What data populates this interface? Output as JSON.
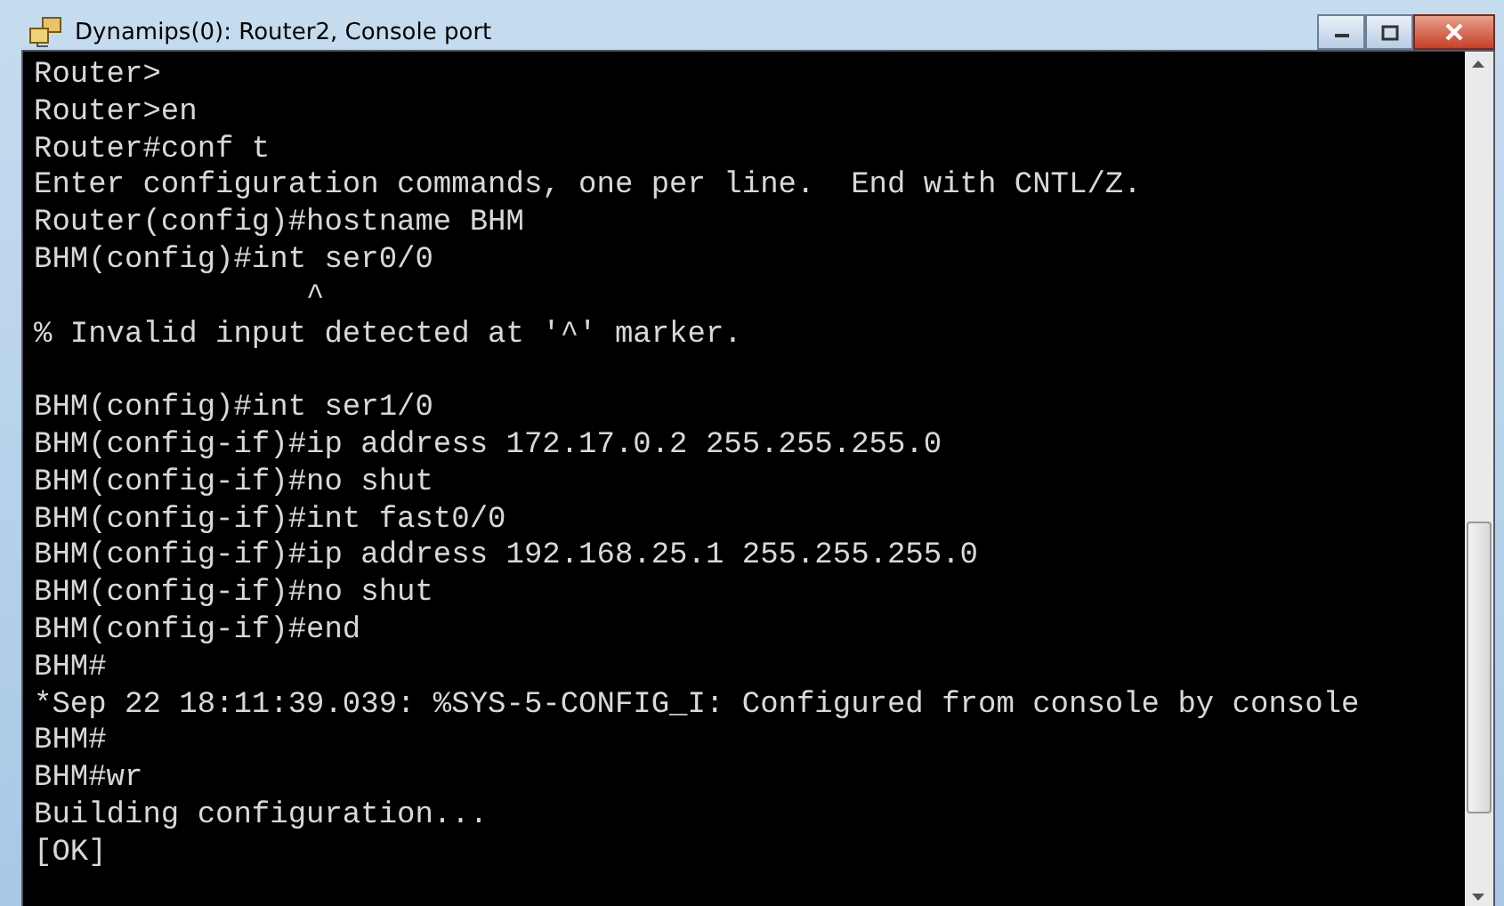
{
  "window": {
    "title": "Dynamips(0): Router2, Console port"
  },
  "console": {
    "blocks": [
      {
        "lines": [
          "Router>",
          "Router>en",
          "Router#conf t",
          "Enter configuration commands, one per line.  End with CNTL/Z.",
          "Router(config)#hostname BHM",
          "BHM(config)#int ser0/0",
          "               ^",
          "% Invalid input detected at '^' marker."
        ]
      },
      {
        "lines": [
          "BHM(config)#int ser1/0",
          "BHM(config-if)#ip address 172.17.0.2 255.255.255.0",
          "BHM(config-if)#no shut",
          "BHM(config-if)#int fast0/0",
          "BHM(config-if)#ip address 192.168.25.1 255.255.255.0",
          "BHM(config-if)#no shut",
          "BHM(config-if)#end",
          "BHM#",
          "*Sep 22 18:11:39.039: %SYS-5-CONFIG_I: Configured from console by console",
          "BHM#",
          "BHM#wr",
          "Building configuration...",
          "[OK]"
        ]
      }
    ]
  }
}
